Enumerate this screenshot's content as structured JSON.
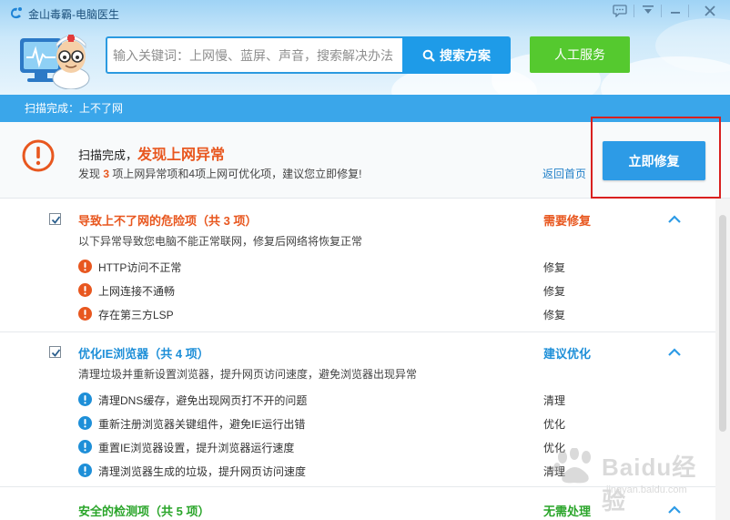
{
  "window": {
    "title": "金山毒霸-电脑医生",
    "controls": {
      "feedback_icon": "chat-bubble-icon",
      "menu_icon": "menu-icon",
      "minimize_icon": "minimize-icon",
      "close_icon": "close-icon"
    }
  },
  "search": {
    "placeholder": "输入关键词：上网慢、蓝屏、声音，搜索解决办法",
    "button_label": "搜索方案"
  },
  "service_button_label": "人工服务",
  "scan_status": "扫描完成：上不了网",
  "summary": {
    "title_prefix": "扫描完成，",
    "title_highlight": "发现上网异常",
    "desc_prefix": "发现",
    "desc_count": "3",
    "desc_suffix": "项上网异常项和4项上网可优化项，建议您立即修复!",
    "back_link": "返回首页",
    "fix_button_label": "立即修复"
  },
  "colors": {
    "accent": "#2d9be6",
    "danger": "#e8571f",
    "safe": "#2aa52a",
    "optimize": "#1e8fd8",
    "service": "#55c92f"
  },
  "sections": [
    {
      "title": "导致上不了网的危险项",
      "count": "（共 3 项）",
      "desc": "以下异常导致您电脑不能正常联网，修复后网络将恢复正常",
      "status": "需要修复",
      "items": [
        {
          "label": "HTTP访问不正常",
          "action": "修复"
        },
        {
          "label": "上网连接不通畅",
          "action": "修复"
        },
        {
          "label": "存在第三方LSP",
          "action": "修复"
        }
      ]
    },
    {
      "title": "优化IE浏览器",
      "count": "（共 4 项）",
      "desc": "清理垃圾并重新设置浏览器，提升网页访问速度，避免浏览器出现异常",
      "status": "建议优化",
      "items": [
        {
          "label": "清理DNS缓存，避免出现网页打不开的问题",
          "action": "清理"
        },
        {
          "label": "重新注册浏览器关键组件，避免IE运行出错",
          "action": "优化"
        },
        {
          "label": "重置IE浏览器设置，提升浏览器运行速度",
          "action": "优化"
        },
        {
          "label": "清理浏览器生成的垃圾，提升网页访问速度",
          "action": "清理"
        }
      ]
    },
    {
      "title": "安全的检测项",
      "count": "（共 5 项）",
      "status": "无需处理"
    }
  ],
  "watermark": {
    "text": "Baidu经验",
    "url": "jingyan.baidu.com"
  }
}
